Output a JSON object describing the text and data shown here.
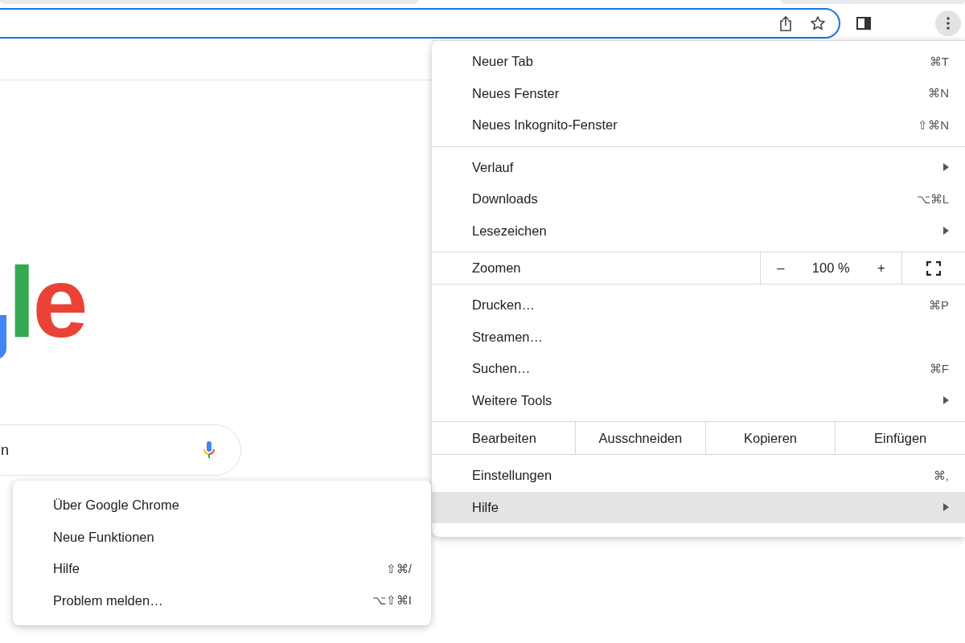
{
  "toolbar": {
    "menu_open": true
  },
  "page": {
    "logo_letters": [
      {
        "char": "l",
        "color": "#34a853"
      },
      {
        "char": "e",
        "color": "#ea4335"
      }
    ],
    "search": {
      "value": "n"
    }
  },
  "menu": {
    "sections": [
      [
        {
          "kind": "item",
          "label": "Neuer Tab",
          "shortcut": "⌘T",
          "submenu": false,
          "selected": false
        },
        {
          "kind": "item",
          "label": "Neues Fenster",
          "shortcut": "⌘N",
          "submenu": false,
          "selected": false
        },
        {
          "kind": "item",
          "label": "Neues Inkognito-Fenster",
          "shortcut": "⇧⌘N",
          "submenu": false,
          "selected": false
        }
      ],
      [
        {
          "kind": "item",
          "label": "Verlauf",
          "submenu": true,
          "selected": false
        },
        {
          "kind": "item",
          "label": "Downloads",
          "shortcut": "⌥⌘L",
          "submenu": false,
          "selected": false
        },
        {
          "kind": "item",
          "label": "Lesezeichen",
          "submenu": true,
          "selected": false
        }
      ],
      [
        {
          "kind": "zoom",
          "label": "Zoomen",
          "minus": "–",
          "value": "100 %",
          "plus": "+"
        }
      ],
      [
        {
          "kind": "item",
          "label": "Drucken…",
          "shortcut": "⌘P",
          "submenu": false,
          "selected": false
        },
        {
          "kind": "item",
          "label": "Streamen…",
          "submenu": false,
          "selected": false
        },
        {
          "kind": "item",
          "label": "Suchen…",
          "shortcut": "⌘F",
          "submenu": false,
          "selected": false
        },
        {
          "kind": "item",
          "label": "Weitere Tools",
          "submenu": true,
          "selected": false
        }
      ],
      [
        {
          "kind": "edit",
          "label": "Bearbeiten",
          "buttons": [
            "Ausschneiden",
            "Kopieren",
            "Einfügen"
          ]
        }
      ],
      [
        {
          "kind": "item",
          "label": "Einstellungen",
          "shortcut": "⌘,",
          "submenu": false,
          "selected": false
        },
        {
          "kind": "item",
          "label": "Hilfe",
          "submenu": true,
          "selected": true
        }
      ]
    ]
  },
  "submenu": {
    "items": [
      {
        "label": "Über Google Chrome"
      },
      {
        "label": "Neue Funktionen"
      },
      {
        "label": "Hilfe",
        "shortcut": "⇧⌘/"
      },
      {
        "label": "Problem melden…",
        "shortcut": "⌥⇧⌘I"
      }
    ]
  }
}
